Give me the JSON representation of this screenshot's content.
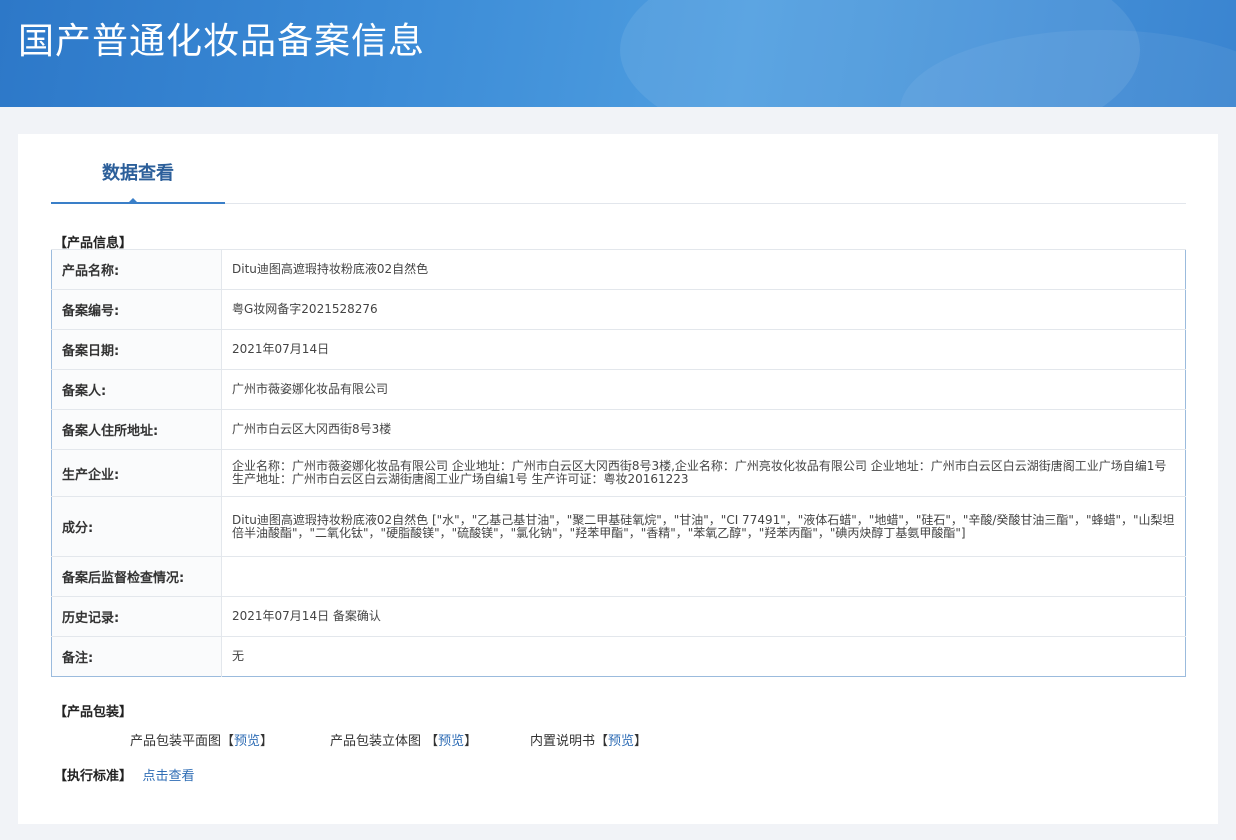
{
  "banner": {
    "title": "国产普通化妆品备案信息"
  },
  "tabs": [
    {
      "label": "数据查看"
    }
  ],
  "product_info": {
    "section_title": "【产品信息】",
    "rows": [
      {
        "label": "产品名称:",
        "value": "Ditu迪图高遮瑕持妆粉底液02自然色"
      },
      {
        "label": "备案编号:",
        "value": "粤G妆网备字2021528276"
      },
      {
        "label": "备案日期:",
        "value": "2021年07月14日"
      },
      {
        "label": "备案人:",
        "value": "广州市薇姿娜化妆品有限公司"
      },
      {
        "label": "备案人住所地址:",
        "value": "广州市白云区大冈西街8号3楼"
      },
      {
        "label": "生产企业:",
        "value": "企业名称：广州市薇姿娜化妆品有限公司 企业地址：广州市白云区大冈西街8号3楼,企业名称：广州亮妆化妆品有限公司 企业地址：广州市白云区白云湖街唐阁工业广场自编1号 生产地址：广州市白云区白云湖街唐阁工业广场自编1号 生产许可证：粤妆20161223"
      },
      {
        "label": "成分:",
        "value": "Ditu迪图高遮瑕持妆粉底液02自然色 [\"水\"，\"乙基己基甘油\"，\"聚二甲基硅氧烷\"，\"甘油\"，\"CI 77491\"，\"液体石蜡\"，\"地蜡\"，\"硅石\"，\"辛酸/癸酸甘油三酯\"，\"蜂蜡\"，\"山梨坦倍半油酸酯\"，\"二氧化钛\"，\"硬脂酸镁\"，\"硫酸镁\"，\"氯化钠\"，\"羟苯甲酯\"，\"香精\"，\"苯氧乙醇\"，\"羟苯丙酯\"，\"碘丙炔醇丁基氨甲酸酯\"]"
      },
      {
        "label": "备案后监督检查情况:",
        "value": ""
      },
      {
        "label": "历史记录:",
        "value": "2021年07月14日 备案确认"
      },
      {
        "label": "备注:",
        "value": "无"
      }
    ]
  },
  "packaging": {
    "section_title": "【产品包装】",
    "items": [
      {
        "label": "产品包装平面图",
        "open": "【",
        "link": "预览",
        "close": "】"
      },
      {
        "label": "产品包装立体图 ",
        "open": "【",
        "link": "预览",
        "close": "】"
      },
      {
        "label": "内置说明书",
        "open": "【",
        "link": "预览",
        "close": "】"
      }
    ]
  },
  "standard": {
    "section_title": "【执行标准】",
    "link": "点击查看"
  }
}
